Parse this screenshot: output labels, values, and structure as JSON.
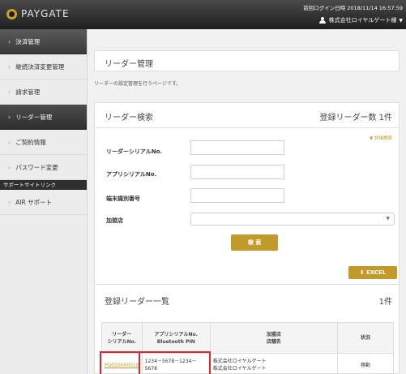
{
  "header": {
    "logo_text": "PAYGATE",
    "last_login": "前回ログイン日時 2018/11/14 16:57:59",
    "user_name": "株式会社ロイヤルゲート様",
    "user_caret": "▼"
  },
  "sidebar": {
    "items": [
      {
        "label": "決済管理"
      },
      {
        "label": "継続決済変更管理"
      },
      {
        "label": "請求管理"
      },
      {
        "label": "リーダー管理"
      },
      {
        "label": "ご契約情報"
      },
      {
        "label": "パスワード変更"
      }
    ],
    "section_label": "サポートサイトリンク",
    "support_item": "AIR サポート"
  },
  "page": {
    "title": "リーダー管理",
    "description": "リーダーの設定管理を行うページです。"
  },
  "search": {
    "title": "リーダー検索",
    "count_label": "登録リーダー数 1件",
    "detail_link": "▼ 詳細検索",
    "fields": {
      "serial_label": "リーダーシリアルNo.",
      "app_serial_label": "アプリシリアルNo.",
      "terminal_label": "端末識別番号",
      "merchant_label": "加盟店"
    },
    "search_button": "検 索",
    "excel_button": "⬇ EXCEL"
  },
  "list": {
    "title": "登録リーダー一覧",
    "count": "1件",
    "headers": {
      "reader_serial": [
        "リーダー",
        "シリアルNo."
      ],
      "app_serial": [
        "アプリシリアルNo.",
        "Bluetooth PIN"
      ],
      "merchant": [
        "加盟店",
        "店舗名"
      ],
      "status": "状況"
    },
    "rows": [
      {
        "reader_serial": "PG010000010",
        "app_serial": "1234－5678－1234－5678",
        "merchant": "株式会社ロイヤルゲート",
        "store": "株式会社ロイヤルゲート",
        "status": "稼動"
      }
    ]
  },
  "colors": {
    "accent": "#c19a2b",
    "highlight": "#e0262f",
    "header_bg": "#2b2b2b"
  }
}
